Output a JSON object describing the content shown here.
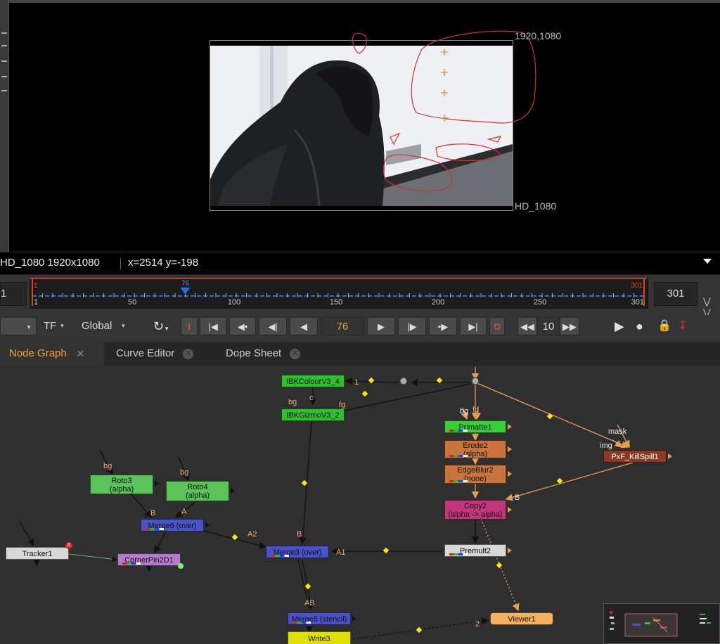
{
  "viewer": {
    "coord_top_right": "1920,1080",
    "format_label": "HD_1080",
    "info_format": "HD_1080 1920x1080",
    "info_coords": "x=2514 y=-198"
  },
  "timeline": {
    "start_frame": "1",
    "end_frame": "301",
    "in_marker": "1",
    "out_marker": "301",
    "current_marker": "76",
    "ticks": [
      "1",
      "50",
      "100",
      "150",
      "200",
      "250",
      "301"
    ]
  },
  "transport": {
    "tf_label": "TF",
    "global_label": "Global",
    "in_label": "I",
    "out_label": "O",
    "current_frame": "76",
    "increment": "10"
  },
  "tabs": [
    {
      "label": "Node Graph",
      "close": "✕"
    },
    {
      "label": "Curve Editor",
      "close": "✕"
    },
    {
      "label": "Dope Sheet",
      "close": "✕"
    }
  ],
  "nodes": {
    "ibkcolour": "IBKColourV3_4",
    "ibkgizmo": "IBKGizmoV3_2",
    "primatte": "Primatte1",
    "erode": "Erode2",
    "erode_sub": "(alpha)",
    "edgeblur": "EdgeBlur2",
    "edgeblur_sub": "(none)",
    "copy": "Copy2",
    "copy_sub": "(alpha -> alpha)",
    "premult": "Premult2",
    "killspill": "PxF_KillSpill1",
    "roto3": "Roto3",
    "roto3_sub": "(alpha)",
    "roto4": "Roto4",
    "roto4_sub": "(alpha)",
    "merge6": "Merge6 (over)",
    "tracker": "Tracker1",
    "tracker_badge": "A",
    "cornerpin": "CornerPin2D1",
    "merge3": "Merge3 (over)",
    "merge5": "Merge5 (stencil)",
    "write3": "Write3",
    "viewer1": "Viewer1"
  },
  "pipe_labels": {
    "ibk_in": "1",
    "bg1": "bg",
    "c": "c",
    "fg1": "fg",
    "bg_prim": "bg",
    "fg_prim": "fg",
    "mask": "mask",
    "img": "img",
    "b_copy": "B",
    "bg_roto3": "bg",
    "bg_roto4": "bg",
    "b_merge6": "B",
    "a_merge6": "A",
    "a2": "A2",
    "b_merge3": "B",
    "a1": "A1",
    "ab": "AB",
    "viewer_in": "2"
  },
  "colors": {
    "accent": "#f7a23a",
    "node_green": "#2fbf2f",
    "node_orange": "#c8743c",
    "node_blue": "#4a52c8",
    "node_pink": "#c2367c"
  }
}
